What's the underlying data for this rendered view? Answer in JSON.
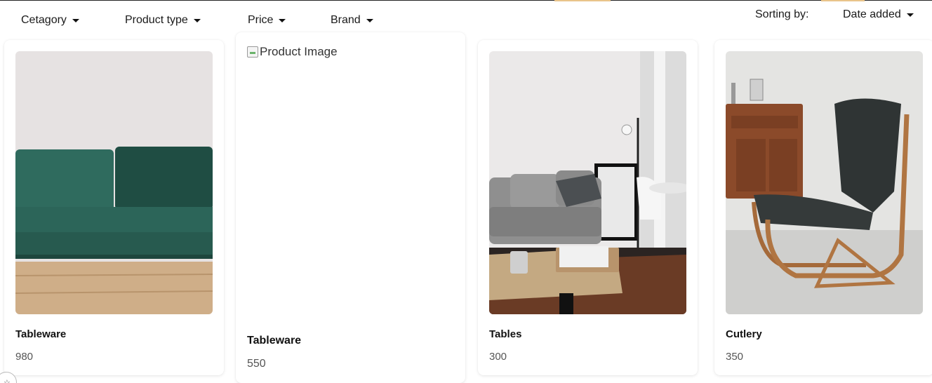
{
  "filters": {
    "category": "Cetagory",
    "product_type": "Product type",
    "price": "Price",
    "brand": "Brand"
  },
  "sorting": {
    "label": "Sorting by:",
    "selected": "Date added"
  },
  "products": [
    {
      "name": "Tableware",
      "price": "980",
      "image": "green-sofa-photo"
    },
    {
      "name": "Tableware",
      "price": "550",
      "image_alt": "Product Image"
    },
    {
      "name": "Tables",
      "price": "300",
      "image": "living-room-photo"
    },
    {
      "name": "Cutlery",
      "price": "350",
      "image": "armchair-photo"
    }
  ],
  "colors": {
    "accent": "#e9c48a",
    "text": "#111111",
    "muted": "#555555"
  }
}
